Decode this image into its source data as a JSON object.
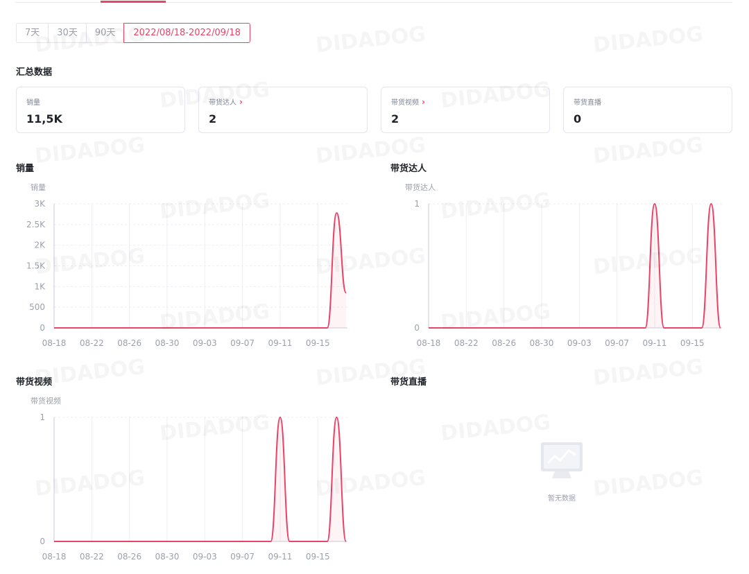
{
  "tabs": [
    "7天",
    "30天",
    "90天",
    "2022/08/18-2022/09/18"
  ],
  "summary": {
    "title": "汇总数据",
    "cards": [
      {
        "label": "销量",
        "value": "11,5K",
        "arrow": ""
      },
      {
        "label": "带货达人",
        "value": "2",
        "arrow": "›"
      },
      {
        "label": "带货视频",
        "value": "2",
        "arrow": "›"
      },
      {
        "label": "带货直播",
        "value": "0",
        "arrow": ""
      }
    ]
  },
  "section_titles": {
    "sales": "销量",
    "influencers": "带货达人",
    "videos": "带货视频",
    "live": "带货直播"
  },
  "empty_text": "暂无数据",
  "watermark_text": "DIDADOG",
  "colors": {
    "accent": "#e94468",
    "grid": "#eceef3",
    "axis_text": "#9aa0ad"
  },
  "chart_data": [
    {
      "type": "line",
      "title": "销量",
      "ylabel": "销量",
      "x_ticks": [
        "08-18",
        "08-22",
        "08-26",
        "08-30",
        "09-03",
        "09-07",
        "09-11",
        "09-15"
      ],
      "y_ticks": [
        "0",
        "500",
        "1K",
        "1.5K",
        "2K",
        "2.5K",
        "3K"
      ],
      "ylim": [
        0,
        3000
      ],
      "x_start": "2022-08-18",
      "x_end": "2022-09-18",
      "series": [
        {
          "name": "销量",
          "points": [
            [
              "2022-09-16",
              0
            ],
            [
              "2022-09-17",
              2780
            ],
            [
              "2022-09-18",
              850
            ]
          ]
        }
      ]
    },
    {
      "type": "line",
      "title": "带货达人",
      "ylabel": "带货达人",
      "x_ticks": [
        "08-18",
        "08-22",
        "08-26",
        "08-30",
        "09-03",
        "09-07",
        "09-11",
        "09-15"
      ],
      "y_ticks": [
        "0",
        "1"
      ],
      "ylim": [
        0,
        1
      ],
      "x_start": "2022-08-18",
      "x_end": "2022-09-18",
      "series": [
        {
          "name": "带货达人",
          "points": [
            [
              "2022-09-10",
              0
            ],
            [
              "2022-09-11",
              1
            ],
            [
              "2022-09-12",
              0
            ],
            [
              "2022-09-16",
              0
            ],
            [
              "2022-09-17",
              1
            ],
            [
              "2022-09-18",
              0
            ]
          ]
        }
      ]
    },
    {
      "type": "line",
      "title": "带货视频",
      "ylabel": "带货视频",
      "x_ticks": [
        "08-18",
        "08-22",
        "08-26",
        "08-30",
        "09-03",
        "09-07",
        "09-11",
        "09-15"
      ],
      "y_ticks": [
        "0",
        "1"
      ],
      "ylim": [
        0,
        1
      ],
      "x_start": "2022-08-18",
      "x_end": "2022-09-18",
      "series": [
        {
          "name": "带货视频",
          "points": [
            [
              "2022-09-10",
              0
            ],
            [
              "2022-09-11",
              1
            ],
            [
              "2022-09-12",
              0
            ],
            [
              "2022-09-16",
              0
            ],
            [
              "2022-09-17",
              1
            ],
            [
              "2022-09-18",
              0
            ]
          ]
        }
      ]
    }
  ]
}
